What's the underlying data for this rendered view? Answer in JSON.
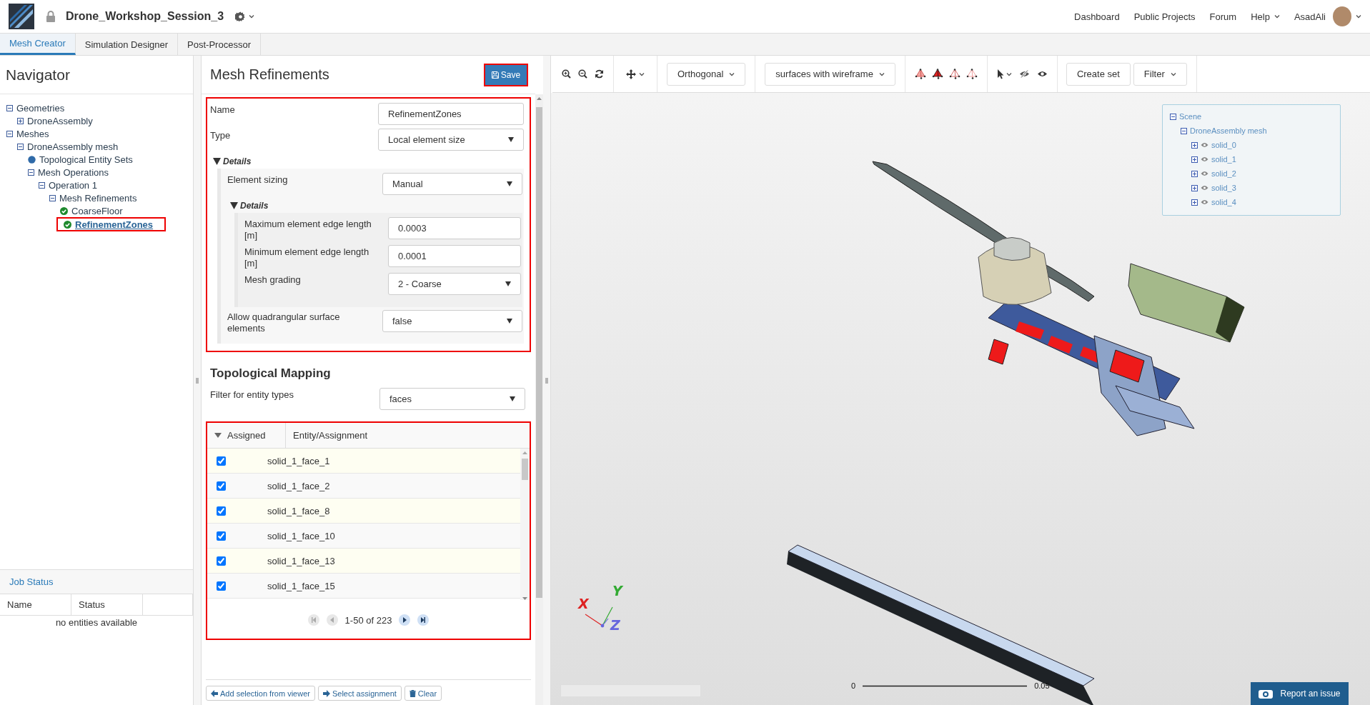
{
  "app": {
    "project_title": "Drone_Workshop_Session_3",
    "nav_links": [
      {
        "label": "Dashboard",
        "has_menu": false
      },
      {
        "label": "Public Projects",
        "has_menu": false
      },
      {
        "label": "Forum",
        "has_menu": false
      },
      {
        "label": "Help",
        "has_menu": true
      }
    ],
    "user": "AsadAli"
  },
  "tabs": [
    {
      "label": "Mesh Creator",
      "selected": true
    },
    {
      "label": "Simulation Designer",
      "selected": false
    },
    {
      "label": "Post-Processor",
      "selected": false
    }
  ],
  "navigator": {
    "title": "Navigator",
    "tree": [
      {
        "kind": "group",
        "label": "Geometries",
        "expanded": true,
        "children": [
          {
            "kind": "group",
            "label": "DroneAssembly",
            "expanded": false
          }
        ]
      },
      {
        "kind": "group",
        "label": "Meshes",
        "expanded": true,
        "children": [
          {
            "kind": "group",
            "label": "DroneAssembly mesh",
            "expanded": true,
            "children": [
              {
                "kind": "entity-set",
                "label": "Topological Entity Sets"
              },
              {
                "kind": "group",
                "label": "Mesh Operations",
                "expanded": true,
                "children": [
                  {
                    "kind": "group",
                    "label": "Operation 1",
                    "expanded": true,
                    "children": [
                      {
                        "kind": "group",
                        "label": "Mesh Refinements",
                        "expanded": true,
                        "children": [
                          {
                            "kind": "refinement",
                            "label": "CoarseFloor",
                            "selected": false,
                            "highlighted": false
                          },
                          {
                            "kind": "refinement",
                            "label": "RefinementZones",
                            "selected": true,
                            "highlighted": true
                          }
                        ]
                      }
                    ]
                  }
                ]
              }
            ]
          }
        ]
      }
    ]
  },
  "job_status": {
    "title": "Job Status",
    "columns": [
      "Name",
      "Status"
    ],
    "empty_text": "no entities available"
  },
  "editor": {
    "title": "Mesh Refinements",
    "save_label": "Save",
    "save_highlighted": true,
    "form_highlighted": true,
    "fields": [
      {
        "kind": "text",
        "label": "Name",
        "value": "RefinementZones"
      },
      {
        "kind": "select",
        "label": "Type",
        "value": "Local element size"
      },
      {
        "kind": "group",
        "label": "Details",
        "expanded": true,
        "fields": [
          {
            "kind": "select",
            "label": "Element sizing",
            "value": "Manual"
          },
          {
            "kind": "group",
            "label": "Details",
            "expanded": true,
            "fields": [
              {
                "kind": "text",
                "label": "Maximum element edge length [m]",
                "value": "0.0003"
              },
              {
                "kind": "text",
                "label": "Minimum element edge length [m]",
                "value": "0.0001"
              },
              {
                "kind": "select",
                "label": "Mesh grading",
                "value": "2 - Coarse"
              }
            ]
          },
          {
            "kind": "select",
            "label": "Allow quadrangular surface elements",
            "value": "false"
          }
        ]
      }
    ]
  },
  "mapping": {
    "title": "Topological Mapping",
    "filter_label": "Filter for entity types",
    "filter_value": "faces",
    "table_highlighted": true,
    "columns": [
      "Assigned",
      "Entity/Assignment"
    ],
    "rows": [
      {
        "checked": true,
        "entity": "solid_1_face_1"
      },
      {
        "checked": true,
        "entity": "solid_1_face_2"
      },
      {
        "checked": true,
        "entity": "solid_1_face_8"
      },
      {
        "checked": true,
        "entity": "solid_1_face_10"
      },
      {
        "checked": true,
        "entity": "solid_1_face_13"
      },
      {
        "checked": true,
        "entity": "solid_1_face_15"
      }
    ],
    "pager": {
      "text": "1-50 of 223",
      "can_go_back": false,
      "can_go_forward": true
    },
    "actions": [
      {
        "kind": "add",
        "label": "Add selection from viewer"
      },
      {
        "kind": "select",
        "label": "Select assignment"
      },
      {
        "kind": "clear",
        "label": "Clear"
      }
    ]
  },
  "viewer": {
    "projection": "Orthogonal",
    "render_mode": "surfaces with wireframe",
    "create_set_label": "Create set",
    "filter_label": "Filter",
    "scene_tree": [
      {
        "label": "Scene",
        "expanded": true,
        "children": [
          {
            "label": "DroneAssembly mesh",
            "expanded": true,
            "children": [
              {
                "label": "solid_0",
                "expanded": false
              },
              {
                "label": "solid_1",
                "expanded": false
              },
              {
                "label": "solid_2",
                "expanded": false
              },
              {
                "label": "solid_3",
                "expanded": false
              },
              {
                "label": "solid_4",
                "expanded": false
              }
            ]
          }
        ]
      }
    ],
    "axes": {
      "x": "X",
      "y": "Y",
      "z": "Z"
    },
    "scale": {
      "min": "0",
      "max": "0.05"
    },
    "report_label": "Report an issue"
  }
}
